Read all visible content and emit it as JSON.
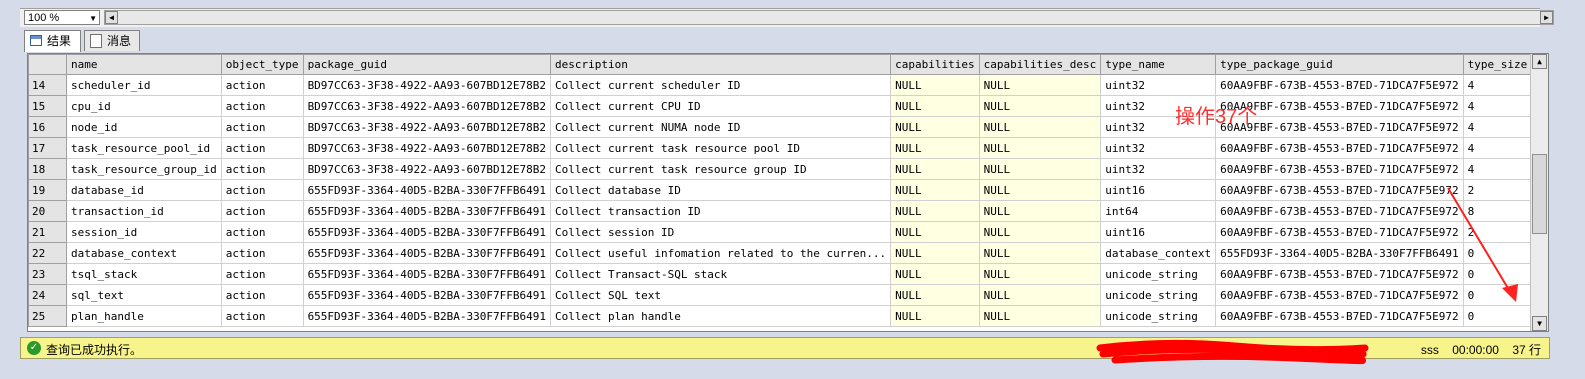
{
  "zoom": {
    "value": "100 %"
  },
  "tabs": [
    {
      "label": "结果",
      "icon": "grid-icon"
    },
    {
      "label": "消息",
      "icon": "messages-icon"
    }
  ],
  "grid": {
    "columns": [
      "name",
      "object_type",
      "package_guid",
      "description",
      "capabilities",
      "capabilities_desc",
      "type_name",
      "type_package_guid",
      "type_size"
    ],
    "rows": [
      [
        "14",
        "scheduler_id",
        "action",
        "BD97CC63-3F38-4922-AA93-607BD12E78B2",
        "Collect current scheduler ID",
        "NULL",
        "NULL",
        "uint32",
        "60AA9FBF-673B-4553-B7ED-71DCA7F5E972",
        "4"
      ],
      [
        "15",
        "cpu_id",
        "action",
        "BD97CC63-3F38-4922-AA93-607BD12E78B2",
        "Collect current CPU ID",
        "NULL",
        "NULL",
        "uint32",
        "60AA9FBF-673B-4553-B7ED-71DCA7F5E972",
        "4"
      ],
      [
        "16",
        "node_id",
        "action",
        "BD97CC63-3F38-4922-AA93-607BD12E78B2",
        "Collect current NUMA node ID",
        "NULL",
        "NULL",
        "uint32",
        "60AA9FBF-673B-4553-B7ED-71DCA7F5E972",
        "4"
      ],
      [
        "17",
        "task_resource_pool_id",
        "action",
        "BD97CC63-3F38-4922-AA93-607BD12E78B2",
        "Collect current task resource pool ID",
        "NULL",
        "NULL",
        "uint32",
        "60AA9FBF-673B-4553-B7ED-71DCA7F5E972",
        "4"
      ],
      [
        "18",
        "task_resource_group_id",
        "action",
        "BD97CC63-3F38-4922-AA93-607BD12E78B2",
        "Collect current task resource group ID",
        "NULL",
        "NULL",
        "uint32",
        "60AA9FBF-673B-4553-B7ED-71DCA7F5E972",
        "4"
      ],
      [
        "19",
        "database_id",
        "action",
        "655FD93F-3364-40D5-B2BA-330F7FFB6491",
        "Collect database ID",
        "NULL",
        "NULL",
        "uint16",
        "60AA9FBF-673B-4553-B7ED-71DCA7F5E972",
        "2"
      ],
      [
        "20",
        "transaction_id",
        "action",
        "655FD93F-3364-40D5-B2BA-330F7FFB6491",
        "Collect transaction ID",
        "NULL",
        "NULL",
        "int64",
        "60AA9FBF-673B-4553-B7ED-71DCA7F5E972",
        "8"
      ],
      [
        "21",
        "session_id",
        "action",
        "655FD93F-3364-40D5-B2BA-330F7FFB6491",
        "Collect session ID",
        "NULL",
        "NULL",
        "uint16",
        "60AA9FBF-673B-4553-B7ED-71DCA7F5E972",
        "2"
      ],
      [
        "22",
        "database_context",
        "action",
        "655FD93F-3364-40D5-B2BA-330F7FFB6491",
        "Collect useful infomation related to the curren...",
        "NULL",
        "NULL",
        "database_context",
        "655FD93F-3364-40D5-B2BA-330F7FFB6491",
        "0"
      ],
      [
        "23",
        "tsql_stack",
        "action",
        "655FD93F-3364-40D5-B2BA-330F7FFB6491",
        "Collect Transact-SQL stack",
        "NULL",
        "NULL",
        "unicode_string",
        "60AA9FBF-673B-4553-B7ED-71DCA7F5E972",
        "0"
      ],
      [
        "24",
        "sql_text",
        "action",
        "655FD93F-3364-40D5-B2BA-330F7FFB6491",
        "Collect SQL text",
        "NULL",
        "NULL",
        "unicode_string",
        "60AA9FBF-673B-4553-B7ED-71DCA7F5E972",
        "0"
      ],
      [
        "25",
        "plan_handle",
        "action",
        "655FD93F-3364-40D5-B2BA-330F7FFB6491",
        "Collect plan handle",
        "NULL",
        "NULL",
        "unicode_string",
        "60AA9FBF-673B-4553-B7ED-71DCA7F5E972",
        "0"
      ]
    ]
  },
  "annotation": "操作37个",
  "status": {
    "message": "查询已成功执行。",
    "server": "sss",
    "elapsed": "00:00:00",
    "rows": "37 行"
  },
  "colors": {
    "status_bg": "#f8f48c",
    "annotation": "#ff3030",
    "null_cell_bg": "#ffffe1"
  }
}
